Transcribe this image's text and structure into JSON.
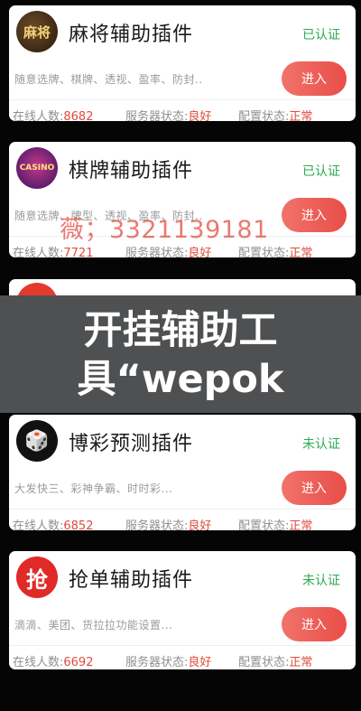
{
  "plugins": [
    {
      "title": "麻将辅助插件",
      "status": "已认证",
      "desc": "随意选牌、棋牌、透视、盈率、防封..",
      "button": "进入",
      "online_label": "在线人数:",
      "online_count": "8682",
      "server_label": "服务器状态:",
      "server_status": "良好",
      "config_label": "配置状态:",
      "config_status": "正常",
      "logo_text": "麻将",
      "logo_icon": "mahjong-logo-icon",
      "status_color": "#2bab52"
    },
    {
      "title": "棋牌辅助插件",
      "status": "已认证",
      "desc": "随意选牌、牌型、透视、盈率、防封..",
      "button": "进入",
      "online_label": "在线人数:",
      "online_count": "7721",
      "server_label": "服务器状态:",
      "server_status": "良好",
      "config_label": "配置状态:",
      "config_status": "正常",
      "logo_text": "CASINO",
      "logo_icon": "casino-logo-icon",
      "status_color": "#2bab52"
    },
    {
      "title": "博彩预测插件",
      "status": "未认证",
      "desc": "大发快三、彩神争霸、时时彩...",
      "button": "进入",
      "online_label": "在线人数:",
      "online_count": "6852",
      "server_label": "服务器状态:",
      "server_status": "良好",
      "config_label": "配置状态:",
      "config_status": "正常",
      "logo_text": "🎲",
      "logo_icon": "dice-logo-icon",
      "status_color": "#2bab52"
    },
    {
      "title": "抢单辅助插件",
      "status": "未认证",
      "desc": "滴滴、美团、货拉拉功能设置...",
      "button": "进入",
      "online_label": "在线人数:",
      "online_count": "6692",
      "server_label": "服务器状态:",
      "server_status": "良好",
      "config_label": "配置状态:",
      "config_status": "正常",
      "logo_text": "抢",
      "logo_icon": "grab-logo-icon",
      "status_color": "#2bab52"
    }
  ],
  "watermark": "薇；3321139181",
  "banner": {
    "line1": "开挂辅助工",
    "line2": "具“wepok"
  },
  "colors": {
    "accent_red": "#e04b3c",
    "button_red": "#ea4d48",
    "verified_green": "#2bab52"
  }
}
